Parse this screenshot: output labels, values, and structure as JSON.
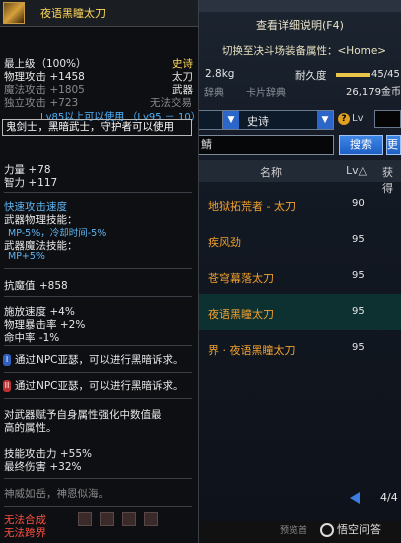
{
  "right_panel": {
    "detail_title": "查看详细说明(F4)",
    "switch_text": "切换至决斗场装备属性：<Home>",
    "weight": "2.8kg",
    "durability_label": "耐久度",
    "durability_value": "45/45",
    "durability_fraction": 1.0,
    "gold": "26,179金币",
    "tabs": [
      "辞典",
      "卡片辞典"
    ],
    "filter_partial": "　",
    "rarity_select": "史诗",
    "lv_icon": "?",
    "lv_label": "Lv",
    "search_value": "鯖",
    "search_button": "搜索",
    "search_button_partial": "更",
    "columns": {
      "name": "名称",
      "lv": "Lv△",
      "extra": "获得"
    },
    "results": [
      {
        "name": "地狱拓荒者 - 太刀",
        "lv": "90",
        "selected": false
      },
      {
        "name": "疾风劲",
        "lv": "95",
        "selected": false
      },
      {
        "name": "苍穹幕落太刀",
        "lv": "95",
        "selected": false
      },
      {
        "name": "夜语黑瞳太刀",
        "lv": "95",
        "selected": true
      },
      {
        "name": "界 · 夜语黑瞳太刀",
        "lv": "95",
        "selected": false
      }
    ],
    "pager": "4/4",
    "bottom_tab": "预览首",
    "watermark": "悟空问答"
  },
  "tooltip": {
    "title": "夜语黑瞳太刀",
    "grade": "最上级（100%）",
    "rarity": "史诗",
    "phys_atk": "物理攻击 +1458",
    "type_label": "太刀",
    "magic_atk": "魔法攻击 +1805",
    "category": "武器",
    "indep_atk": "独立攻击 +723",
    "trade": "无法交易",
    "lv_req": "Lv85以上可以使用 （Lv95 － 10）",
    "classes": "鬼剑士，黑暗武士，守护者可以使用",
    "str": "力量 +78",
    "int": "智力 +117",
    "skill_atk_speed": "快速攻击速度",
    "weapon_phys_skill": "武器物理技能：",
    "phys_skill_detail": "MP-5%，冷却时间-5%",
    "weapon_magic_skill": "武器魔法技能：",
    "magic_skill_detail": "MP+5%",
    "dark_res": "抗魔值 +858",
    "cast_speed": "施放速度 +4%",
    "phys_crit": "物理暴击率 +2%",
    "hit_rate": "命中率 -1%",
    "quest1": "通过NPC亚瑟，可以进行黑暗诉求。",
    "quest2": "通过NPC亚瑟，可以进行黑暗诉求。",
    "enhance_desc_1": "对武器赋予自身属性强化中数值最",
    "enhance_desc_2": "高的属性。",
    "skill_power": "技能攻击力 +55%",
    "final_dmg": "最终伤害 +32%",
    "flavor": "神威如岳，神恩似海。",
    "no_combine": "无法合成",
    "no_cross": "无法跨界"
  }
}
